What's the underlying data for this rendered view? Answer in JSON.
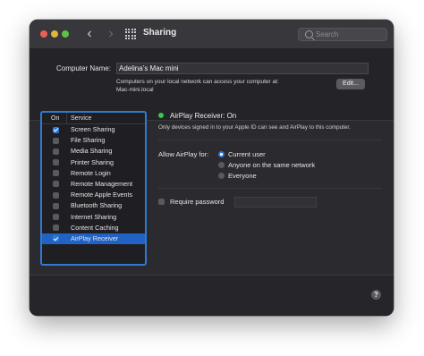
{
  "window": {
    "title": "Sharing"
  },
  "search": {
    "placeholder": "Search"
  },
  "computer": {
    "name_label": "Computer Name:",
    "name_value": "Adelina’s Mac mini",
    "note_line1": "Computers on your local network can access your computer at:",
    "note_line2": "Mac-mini.local",
    "edit_label": "Edit..."
  },
  "services": {
    "header_on": "On",
    "header_service": "Service",
    "items": [
      {
        "name": "Screen Sharing",
        "checked": true,
        "selected": false
      },
      {
        "name": "File Sharing",
        "checked": false,
        "selected": false
      },
      {
        "name": "Media Sharing",
        "checked": false,
        "selected": false
      },
      {
        "name": "Printer Sharing",
        "checked": false,
        "selected": false
      },
      {
        "name": "Remote Login",
        "checked": false,
        "selected": false
      },
      {
        "name": "Remote Management",
        "checked": false,
        "selected": false
      },
      {
        "name": "Remote Apple Events",
        "checked": false,
        "selected": false
      },
      {
        "name": "Bluetooth Sharing",
        "checked": false,
        "selected": false
      },
      {
        "name": "Internet Sharing",
        "checked": false,
        "selected": false
      },
      {
        "name": "Content Caching",
        "checked": false,
        "selected": false
      },
      {
        "name": "AirPlay Receiver",
        "checked": true,
        "selected": true
      }
    ]
  },
  "detail": {
    "status_title": "AirPlay Receiver: On",
    "status_desc": "Only devices signed in to your Apple ID can see and AirPlay to this computer.",
    "allow_label": "Allow AirPlay for:",
    "allow_options": [
      {
        "label": "Current user",
        "selected": true
      },
      {
        "label": "Anyone on the same network",
        "selected": false
      },
      {
        "label": "Everyone",
        "selected": false
      }
    ],
    "require_password_label": "Require password",
    "require_password_checked": false
  },
  "help": {
    "label": "?"
  },
  "colors": {
    "accent": "#2f7ad6",
    "status_on": "#3bc44b"
  }
}
